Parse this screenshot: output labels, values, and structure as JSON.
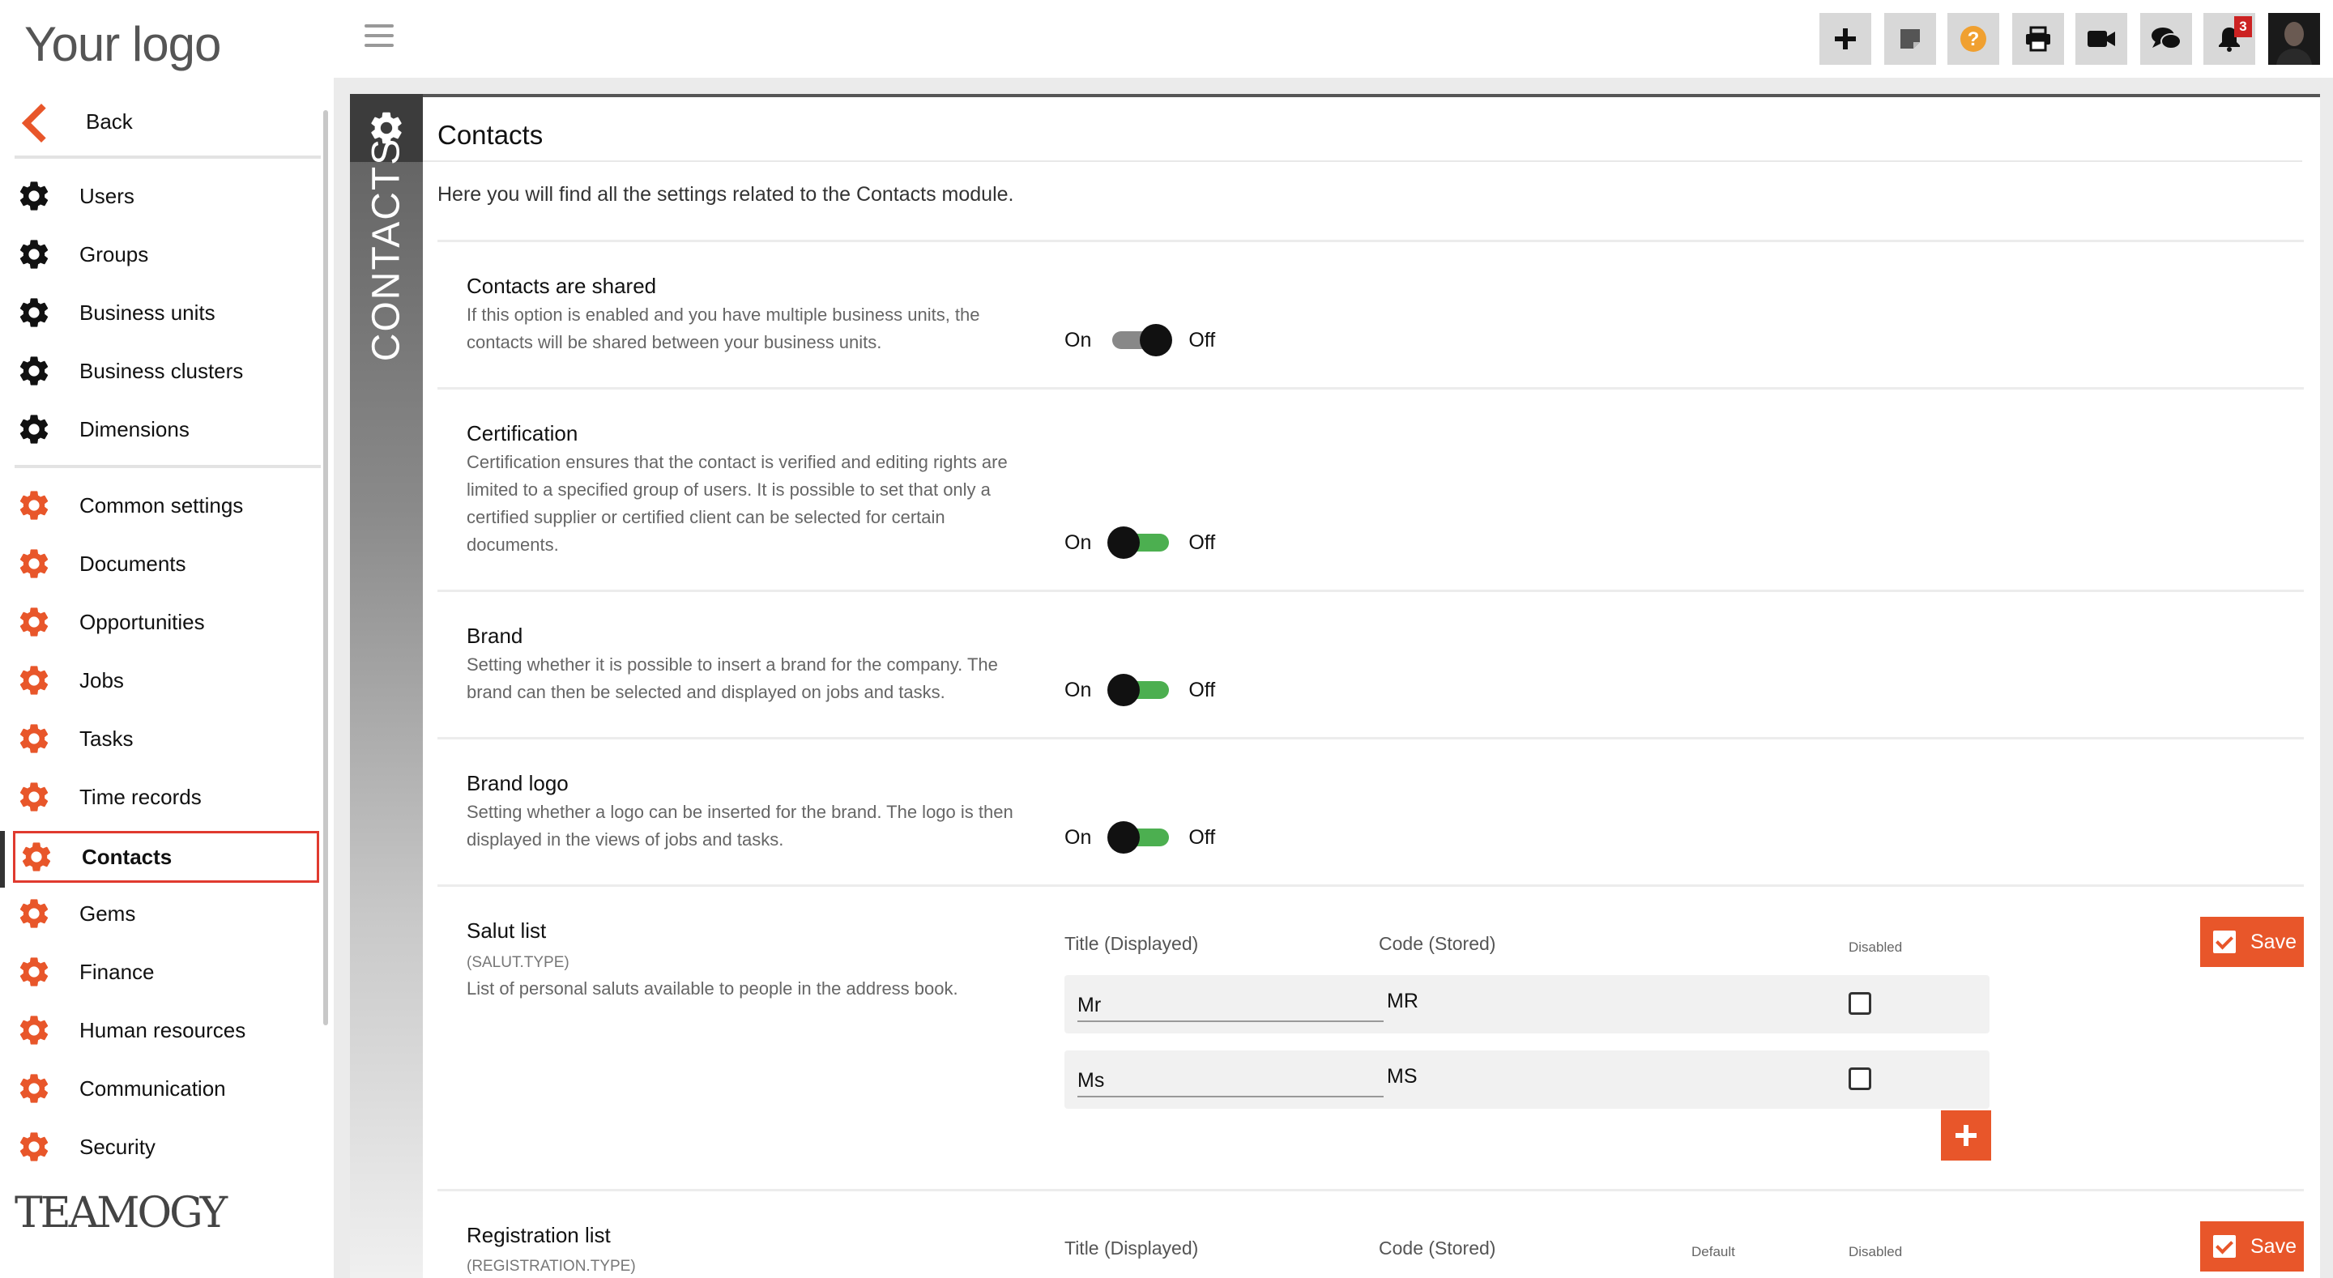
{
  "sidebar": {
    "logo": "Your logo",
    "back_label": "Back",
    "admin_items": [
      {
        "label": "Users",
        "icon": "gear-icon"
      },
      {
        "label": "Groups",
        "icon": "gear-icon"
      },
      {
        "label": "Business units",
        "icon": "gear-icon"
      },
      {
        "label": "Business clusters",
        "icon": "gear-icon"
      },
      {
        "label": "Dimensions",
        "icon": "gear-icon"
      }
    ],
    "module_items": [
      {
        "label": "Common settings",
        "icon": "gear-icon"
      },
      {
        "label": "Documents",
        "icon": "gear-icon"
      },
      {
        "label": "Opportunities",
        "icon": "gear-icon"
      },
      {
        "label": "Jobs",
        "icon": "gear-icon"
      },
      {
        "label": "Tasks",
        "icon": "gear-icon"
      },
      {
        "label": "Time records",
        "icon": "gear-icon"
      },
      {
        "label": "Contacts",
        "icon": "gear-icon",
        "active": true
      },
      {
        "label": "Gems",
        "icon": "gear-icon"
      },
      {
        "label": "Finance",
        "icon": "gear-icon"
      },
      {
        "label": "Human resources",
        "icon": "gear-icon"
      },
      {
        "label": "Communication",
        "icon": "gear-icon"
      },
      {
        "label": "Security",
        "icon": "gear-icon"
      }
    ],
    "brand": "TEAMOGY"
  },
  "topbar": {
    "buttons": [
      {
        "icon": "plus-icon"
      },
      {
        "icon": "sticky-note-icon"
      },
      {
        "icon": "help-icon"
      },
      {
        "icon": "print-icon"
      },
      {
        "icon": "video-camera-icon"
      },
      {
        "icon": "chat-icon"
      },
      {
        "icon": "bell-icon",
        "badge": "3"
      }
    ],
    "avatar_icon": "user-avatar"
  },
  "page": {
    "strip_label": "CONTACTS",
    "title": "Contacts",
    "description": "Here you will find all the settings related to the Contacts module."
  },
  "settings": {
    "on_label": "On",
    "off_label": "Off",
    "shared": {
      "title": "Contacts are shared",
      "desc": "If this option is enabled and you have multiple business units, the contacts will be shared between your business units.",
      "state": "off"
    },
    "certification": {
      "title": "Certification",
      "desc": "Certification ensures that the contact is verified and editing rights are limited to a specified group of users. It is possible to set that only a certified supplier or certified client can be selected for certain documents.",
      "state": "on"
    },
    "brand": {
      "title": "Brand",
      "desc": "Setting whether it is possible to insert a brand for the company. The brand can then be selected and displayed on jobs and tasks.",
      "state": "on"
    },
    "brand_logo": {
      "title": "Brand logo",
      "desc": "Setting whether a logo can be inserted for the brand. The logo is then displayed in the views of jobs and tasks.",
      "state": "on"
    }
  },
  "salut_list": {
    "title": "Salut list",
    "code": "(SALUT.TYPE)",
    "desc": "List of personal saluts available to people in the address book.",
    "col_title": "Title (Displayed)",
    "col_code": "Code (Stored)",
    "col_disabled": "Disabled",
    "save_label": "Save",
    "rows": [
      {
        "title": "Mr",
        "code": "MR",
        "disabled": false
      },
      {
        "title": "Ms",
        "code": "MS",
        "disabled": false
      }
    ]
  },
  "registration_list": {
    "title": "Registration list",
    "code": "(REGISTRATION.TYPE)",
    "col_title": "Title (Displayed)",
    "col_code": "Code (Stored)",
    "col_default": "Default",
    "col_disabled": "Disabled",
    "save_label": "Save"
  },
  "colors": {
    "accent": "#e8562a",
    "toggle_on": "#4caf50",
    "toggle_off": "#888888",
    "active_border": "#e03a2f"
  }
}
